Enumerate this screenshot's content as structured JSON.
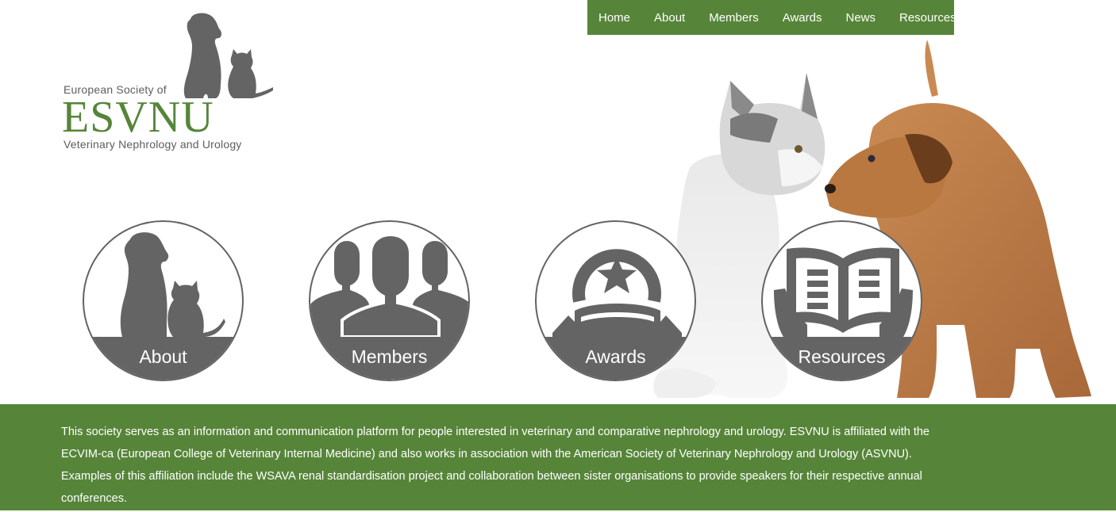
{
  "nav": {
    "items": [
      "Home",
      "About",
      "Members",
      "Awards",
      "News",
      "Resources"
    ]
  },
  "logo": {
    "top_line": "European Society of",
    "acronym": "ESVNU",
    "bottom_line": "Veterinary Nephrology and Urology"
  },
  "circles": [
    {
      "label": "About",
      "icon": "dog-cat-icon"
    },
    {
      "label": "Members",
      "icon": "people-icon"
    },
    {
      "label": "Awards",
      "icon": "award-star-icon"
    },
    {
      "label": "Resources",
      "icon": "open-book-icon"
    }
  ],
  "info": {
    "text": "This society serves as an information and communication platform for people interested in veterinary and comparative nephrology and urology. ESVNU is affiliated with the ECVIM-ca (European College of Veterinary Internal Medicine) and also works in association with the American Society of Veterinary Nephrology and Urology (ASVNU). Examples of this affiliation include the WSAVA renal standardisation project and collaboration between sister organisations to provide speakers for their respective annual conferences."
  },
  "colors": {
    "brand_green": "#568539",
    "icon_gray": "#646464",
    "text_gray": "#5e5e5e"
  }
}
